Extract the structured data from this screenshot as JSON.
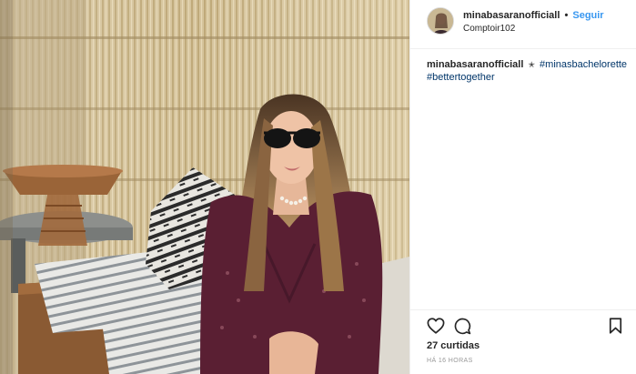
{
  "header": {
    "username": "minabasaranofficiall",
    "separator": "•",
    "follow_label": "Seguir",
    "location": "Comptoir102"
  },
  "caption": {
    "username": "minabasaranofficiall",
    "star": "✭",
    "hashtags": [
      "#minasbachelorette",
      "#bettertogether"
    ]
  },
  "actions": {
    "like_icon": "heart-outline-icon",
    "comment_icon": "speech-bubble-icon",
    "save_icon": "bookmark-icon"
  },
  "likes_text": "27 curtidas",
  "time_text": "HÁ 16 HORAS",
  "colors": {
    "link_blue": "#3897f0",
    "hashtag_blue": "#003569",
    "muted_gray": "#999999",
    "divider": "#efefef"
  }
}
